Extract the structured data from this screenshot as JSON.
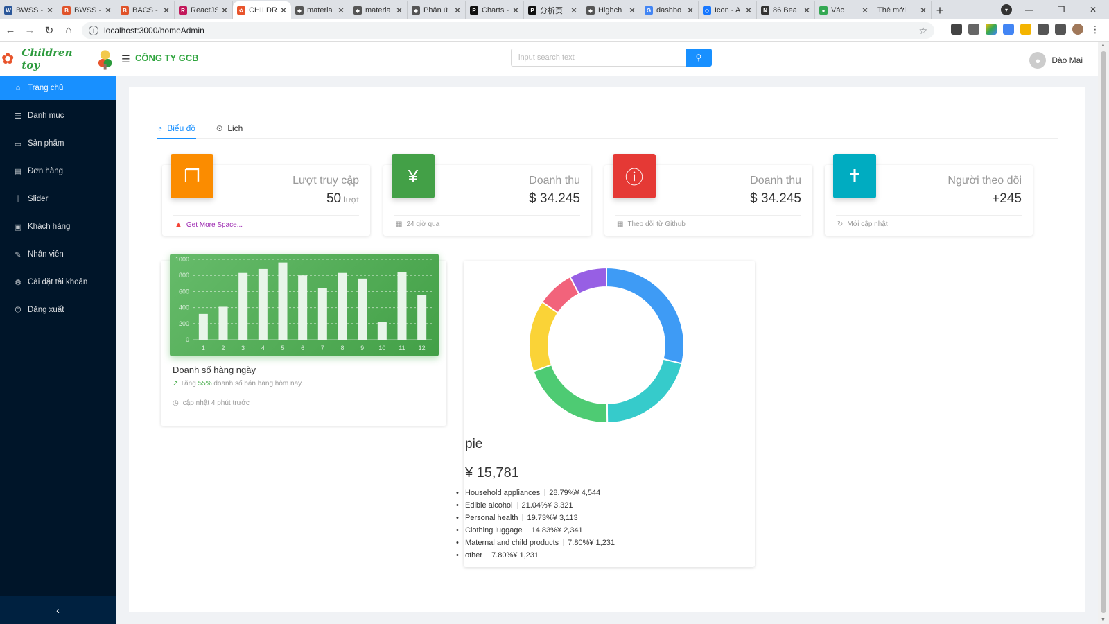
{
  "browser": {
    "tabs": [
      {
        "label": "BWSS -",
        "icon": "word-icon",
        "color": "#2b579a",
        "glyph": "W"
      },
      {
        "label": "BWSS -",
        "icon": "brave-icon",
        "color": "#e0532a",
        "glyph": "B"
      },
      {
        "label": "BACS -",
        "icon": "brave-icon",
        "color": "#e0532a",
        "glyph": "B"
      },
      {
        "label": "ReactJS",
        "icon": "react-icon",
        "color": "#c2185b",
        "glyph": "R"
      },
      {
        "label": "CHILDR",
        "icon": "flower-icon",
        "color": "#e8542c",
        "glyph": "✿",
        "active": true
      },
      {
        "label": "materia",
        "icon": "codesandbox-icon",
        "color": "#555",
        "glyph": "◆"
      },
      {
        "label": "materia",
        "icon": "codesandbox-icon",
        "color": "#555",
        "glyph": "◆"
      },
      {
        "label": "Phản ứ",
        "icon": "codesandbox-icon",
        "color": "#555",
        "glyph": "◆"
      },
      {
        "label": "Charts -",
        "icon": "pro-icon",
        "color": "#111",
        "glyph": "P"
      },
      {
        "label": "分析页",
        "icon": "pro-icon",
        "color": "#111",
        "glyph": "P"
      },
      {
        "label": "Highch",
        "icon": "codesandbox-icon",
        "color": "#555",
        "glyph": "◆"
      },
      {
        "label": "dashbo",
        "icon": "google-icon",
        "color": "#4285f4",
        "glyph": "G"
      },
      {
        "label": "Icon - A",
        "icon": "antd-icon",
        "color": "#1677ff",
        "glyph": "◇"
      },
      {
        "label": "86 Bea",
        "icon": "bookmark-icon",
        "color": "#333",
        "glyph": "N"
      },
      {
        "label": "Vác",
        "icon": "chrome-icon",
        "color": "#34a853",
        "glyph": "●"
      },
      {
        "label": "Thẻ mới",
        "icon": "newtab-icon",
        "color": "transparent",
        "glyph": ""
      }
    ],
    "url": "localhost:3000/homeAdmin"
  },
  "header": {
    "logo_text": "Children toy",
    "company": "CÔNG TY GCB",
    "search_placeholder": "input search text",
    "user_name": "Đào Mai"
  },
  "sidebar": {
    "items": [
      {
        "label": "Trang chủ",
        "icon": "home-icon",
        "glyph": "⌂",
        "active": true
      },
      {
        "label": "Danh mục",
        "icon": "list-icon",
        "glyph": "☰"
      },
      {
        "label": "Sản phẩm",
        "icon": "desktop-icon",
        "glyph": "▭"
      },
      {
        "label": "Đơn hàng",
        "icon": "order-icon",
        "glyph": "▤"
      },
      {
        "label": "Slider",
        "icon": "slider-icon",
        "glyph": "⫼"
      },
      {
        "label": "Khách hàng",
        "icon": "customer-icon",
        "glyph": "▣"
      },
      {
        "label": "Nhân viên",
        "icon": "edit-icon",
        "glyph": "✎"
      },
      {
        "label": "Cài đặt tài khoản",
        "icon": "gear-icon",
        "glyph": "⚙"
      },
      {
        "label": "Đăng xuất",
        "icon": "logout-icon",
        "glyph": "⏻"
      }
    ]
  },
  "content_tabs": [
    {
      "label": "Biểu đồ",
      "icon": "chart-icon",
      "glyph": "◔",
      "active": true
    },
    {
      "label": "Lịch",
      "icon": "calendar-icon",
      "glyph": "⏲"
    }
  ],
  "stats": [
    {
      "title": "Lượt truy cập",
      "value": "50",
      "unit": "lượt",
      "footer": "Get More Space...",
      "color": "#fb8c00",
      "icon": "copy-icon",
      "glyph": "❐",
      "foot_icon": "warning-icon",
      "warn": true
    },
    {
      "title": "Doanh thu",
      "value": "$ 34.245",
      "unit": "",
      "footer": "24 giờ qua",
      "color": "#43a047",
      "icon": "yen-icon",
      "glyph": "¥",
      "foot_icon": "calendar-icon"
    },
    {
      "title": "Doanh thu",
      "value": "$ 34.245",
      "unit": "",
      "footer": "Theo dõi từ Github",
      "color": "#e53935",
      "icon": "info-icon",
      "glyph": "ⓘ",
      "foot_icon": "calendar-icon"
    },
    {
      "title": "Người theo dõi",
      "value": "+245",
      "unit": "",
      "footer": "Mới cập nhật",
      "color": "#00acc1",
      "icon": "accessibility-icon",
      "glyph": "✝",
      "foot_icon": "refresh-icon"
    }
  ],
  "bar_card": {
    "title": "Doanh số hàng ngày",
    "sub_prefix": "Tăng",
    "sub_pct": "55%",
    "sub_suffix": "doanh số bán hàng hôm nay.",
    "footer": "cập nhật 4 phút trước"
  },
  "pie_card": {
    "title": "pie",
    "total": "¥ 15,781",
    "legend": [
      {
        "name": "Household appliances",
        "pct": "28.79%",
        "amount": "¥ 4,544"
      },
      {
        "name": "Edible alcohol",
        "pct": "21.04%",
        "amount": "¥ 3,321"
      },
      {
        "name": "Personal health",
        "pct": "19.73%",
        "amount": "¥ 3,113"
      },
      {
        "name": "Clothing luggage",
        "pct": "14.83%",
        "amount": "¥ 2,341"
      },
      {
        "name": "Maternal and child products",
        "pct": "7.80%",
        "amount": "¥ 1,231"
      },
      {
        "name": "other",
        "pct": "7.80%",
        "amount": "¥ 1,231"
      }
    ]
  },
  "chart_data": [
    {
      "type": "bar",
      "categories": [
        "1",
        "2",
        "3",
        "4",
        "5",
        "6",
        "7",
        "8",
        "9",
        "10",
        "11",
        "12"
      ],
      "values": [
        320,
        410,
        830,
        880,
        960,
        800,
        640,
        830,
        760,
        220,
        840,
        560
      ],
      "ylim": [
        0,
        1000
      ],
      "yticks": [
        0,
        200,
        400,
        600,
        800,
        1000
      ],
      "grid": true,
      "bar_color": "#e8f5e9"
    },
    {
      "type": "pie",
      "variant": "donut",
      "categories": [
        "Household appliances",
        "Edible alcohol",
        "Personal health",
        "Clothing luggage",
        "Maternal and child products",
        "other"
      ],
      "values": [
        4544,
        3321,
        3113,
        2341,
        1231,
        1231
      ],
      "colors": [
        "#3e9bf5",
        "#36cbcb",
        "#4ecb73",
        "#fad337",
        "#f2637b",
        "#975fe4"
      ]
    }
  ]
}
